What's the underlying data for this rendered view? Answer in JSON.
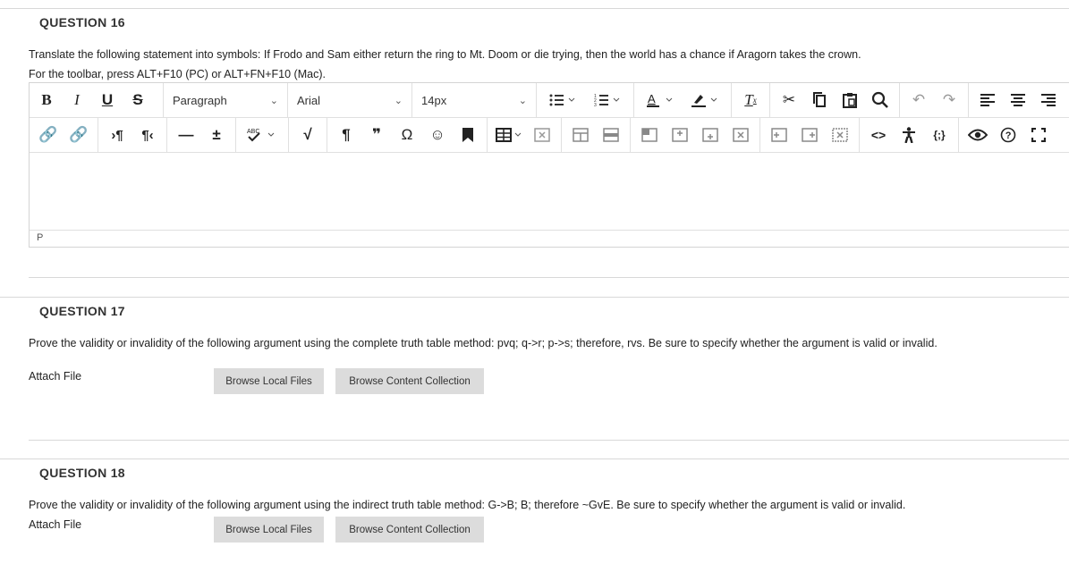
{
  "questions": [
    {
      "title": "QUESTION 16",
      "text": "Translate the following statement into symbols: If Frodo and Sam either return the ring to Mt. Doom or die trying, then the world has a chance if Aragorn takes the crown.",
      "toolbar_hint": "For the toolbar, press ALT+F10 (PC) or ALT+FN+F10 (Mac)."
    },
    {
      "title": "QUESTION 17",
      "text": "Prove the validity or invalidity of the following argument using the complete truth table method: pvq; q->r; p->s; therefore, rvs. Be sure to specify whether the argument is valid or invalid.",
      "attach_label": "Attach File",
      "browse_local": "Browse Local Files",
      "browse_collection": "Browse Content Collection"
    },
    {
      "title": "QUESTION 18",
      "text": "Prove the validity or invalidity of the following argument using the indirect truth table method: G->B; B; therefore ~GvE. Be sure to specify whether the argument is valid or invalid.",
      "attach_label": "Attach File",
      "browse_local": "Browse Local Files",
      "browse_collection": "Browse Content Collection"
    }
  ],
  "editor": {
    "block_format": "Paragraph",
    "font_family": "Arial",
    "font_size": "14px",
    "status_path": "P",
    "toolbar_row1": [
      "bold-icon",
      "italic-icon",
      "underline-icon",
      "strikethrough-icon",
      "bullet-list-icon",
      "numbered-list-icon",
      "text-color-icon",
      "highlight-icon",
      "clear-format-icon",
      "cut-icon",
      "copy-icon",
      "paste-icon",
      "search-icon",
      "undo-icon",
      "redo-icon",
      "align-left-icon",
      "align-center-icon",
      "align-right-icon"
    ],
    "toolbar_row2": [
      "link-icon",
      "unlink-icon",
      "ltr-icon",
      "rtl-icon",
      "horizontal-rule-icon",
      "insert-icon",
      "spellcheck-icon",
      "math-icon",
      "pilcrow-icon",
      "quote-icon",
      "omega-icon",
      "emoji-icon",
      "bookmark-icon",
      "table-icon",
      "table-delete-icon",
      "table-row-icons",
      "code-icon",
      "accessibility-icon",
      "source-icon",
      "preview-icon",
      "help-icon",
      "fullscreen-icon"
    ]
  },
  "glyphs": {
    "bold": "B",
    "italic": "I",
    "underline": "U",
    "strike": "S",
    "rtl": "¶‹",
    "pilcrow": "¶",
    "quote": "❞",
    "omega": "Ω",
    "code": "<>",
    "source": "{;}",
    "spellcheck": "ABC"
  }
}
